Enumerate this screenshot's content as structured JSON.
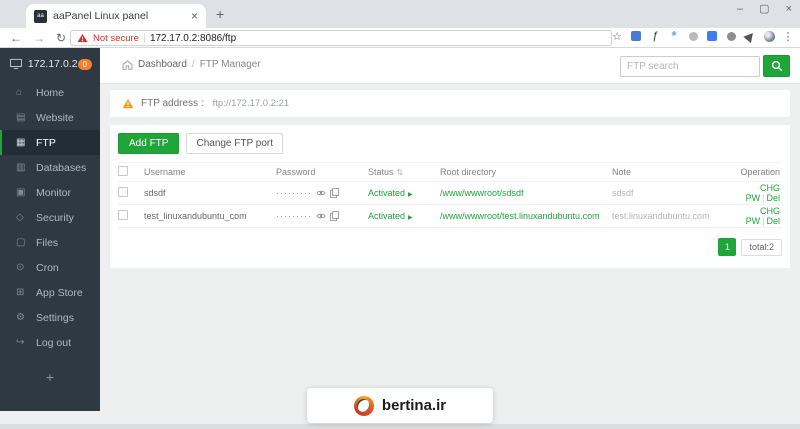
{
  "browser": {
    "tab_title": "aaPanel Linux panel",
    "security_label": "Not secure",
    "url": "172.17.0.2:8086/ftp"
  },
  "icons": {
    "favicon_text": "aa",
    "close": "×",
    "new_tab": "+",
    "minimize": "–",
    "restore": "▢",
    "window_close": "×",
    "back": "←",
    "forward": "→",
    "reload": "↻",
    "star": "☆",
    "menu": "⋮",
    "func_ext": "ƒ",
    "asterisk_ext": "*",
    "sort": "⇅",
    "play": "▶",
    "breadcrumb_sep": "/"
  },
  "sidebar": {
    "server_ip": "172.17.0.2",
    "badge_count": "0",
    "items": [
      {
        "label": "Home",
        "icon": "⌂"
      },
      {
        "label": "Website",
        "icon": "▤"
      },
      {
        "label": "FTP",
        "icon": "▦"
      },
      {
        "label": "Databases",
        "icon": "▥"
      },
      {
        "label": "Monitor",
        "icon": "▣"
      },
      {
        "label": "Security",
        "icon": "◇"
      },
      {
        "label": "Files",
        "icon": "▢"
      },
      {
        "label": "Cron",
        "icon": "⊙"
      },
      {
        "label": "App Store",
        "icon": "⊞"
      },
      {
        "label": "Settings",
        "icon": "⚙"
      },
      {
        "label": "Log out",
        "icon": "↪"
      }
    ],
    "add_label": "+"
  },
  "breadcrumb": {
    "home": "Dashboard",
    "current": "FTP Manager"
  },
  "search": {
    "placeholder": "FTP search"
  },
  "notice": {
    "label": "FTP address :",
    "value": "ftp://172.17.0.2:21"
  },
  "toolbar": {
    "add_ftp": "Add FTP",
    "change_port": "Change FTP port"
  },
  "table": {
    "headers": {
      "username": "Username",
      "password": "Password",
      "status": "Status",
      "root": "Root directory",
      "note": "Note",
      "operation": "Operation"
    },
    "rows": [
      {
        "username": "sdsdf",
        "password": "·········",
        "status": "Activated",
        "root": "/www/wwwroot/sdsdf",
        "note": "sdsdf",
        "chg_pw": "CHG PW",
        "sep": "|",
        "del": "Del"
      },
      {
        "username": "test_linuxandubuntu_com",
        "password": "·········",
        "status": "Activated",
        "root": "/www/wwwroot/test.linuxandubuntu.com",
        "note": "test.linuxandubuntu.com",
        "chg_pw": "CHG PW",
        "sep": "|",
        "del": "Del"
      }
    ]
  },
  "pagination": {
    "page": "1",
    "total": "total:2"
  },
  "watermark": {
    "text": "bertina.ir"
  },
  "colors": {
    "accent_green": "#20a53a",
    "danger_red": "#d93025",
    "warning_orange": "#f0a125",
    "badge_orange": "#f57f2c",
    "sidebar_dark": "#2e3944"
  }
}
